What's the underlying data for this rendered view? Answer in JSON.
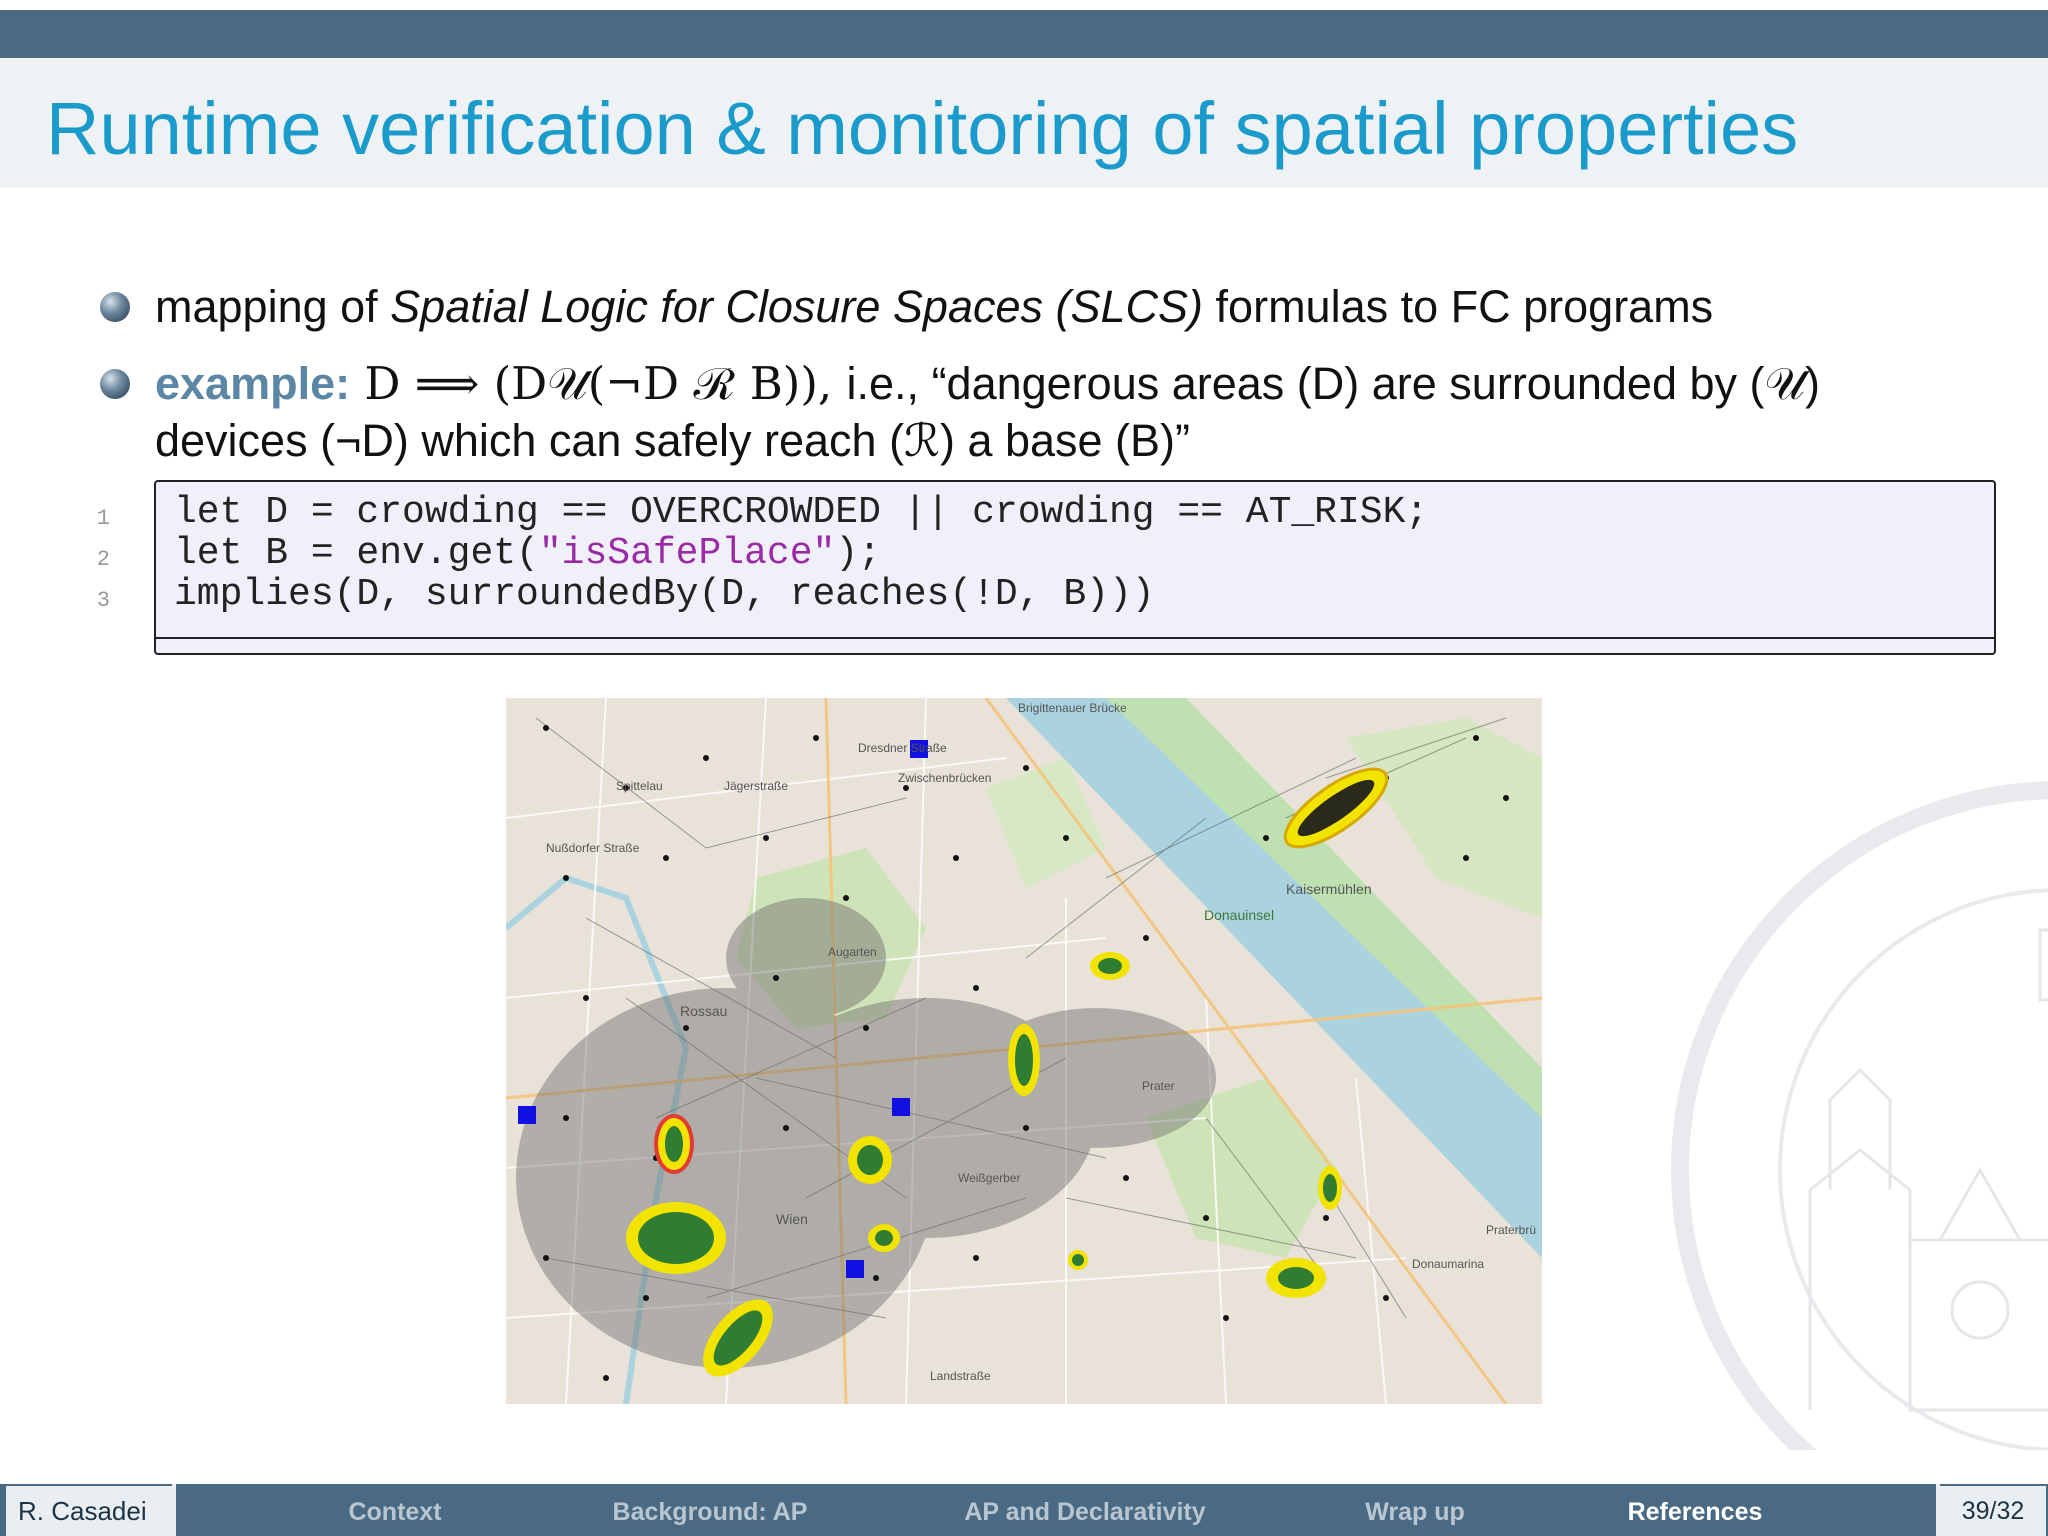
{
  "title": "Runtime verification & monitoring of spatial properties",
  "bullets": {
    "b1_pre": "mapping of ",
    "b1_em": "Spatial Logic for Closure Spaces (SLCS)",
    "b1_post": " formulas to FC programs",
    "b2_label": "example:",
    "b2_formula": " D ⟹ (D𝒰(¬D ℛ B)), ",
    "b2_text": "i.e., “dangerous areas (D) are surrounded by (𝒰)",
    "b2_line2": "devices (¬D) which can safely reach (ℛ) a base (B)”"
  },
  "code": {
    "lines": [
      {
        "num": "1",
        "text": "let D = crowding == OVERCROWDED || crowding == AT_RISK;"
      },
      {
        "num": "2",
        "pre": "let B = env.get(",
        "str": "\"isSafePlace\"",
        "post": ");"
      },
      {
        "num": "3",
        "text": "implies(D, surroundedBy(D, reaches(!D, B)))"
      }
    ]
  },
  "map": {
    "labels": [
      "Brigittenauer Brücke",
      "Zwischenbrücken",
      "Dresdner Straße",
      "Jägerstraße",
      "Spittelau",
      "Nußdorfer Straße",
      "Donauinsel",
      "Kaisermühlen",
      "Augarten",
      "Rossau",
      "Wien",
      "Weißgerber",
      "Prater",
      "Landstraße",
      "Donaumarina",
      "Praterbrü"
    ]
  },
  "footer": {
    "author": "R. Casadei",
    "nav": [
      "Context",
      "Background: AP",
      "AP and Declarativity",
      "Wrap up",
      "References"
    ],
    "page": "39/32"
  },
  "colors": {
    "title": "#1a9bcb",
    "bar": "#4a6a83",
    "example_label": "#5b86a6",
    "string": "#9a2ba5"
  }
}
